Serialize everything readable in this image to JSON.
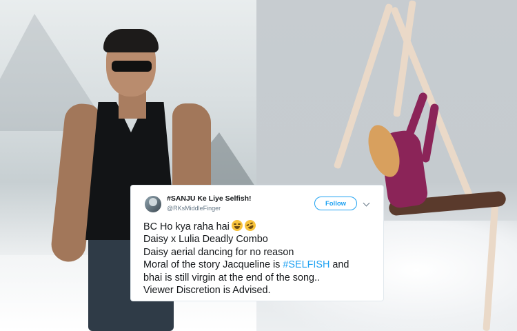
{
  "tweet": {
    "display_name": "#SANJU Ke Liye Selfish!",
    "handle": "@RKsMiddleFinger",
    "follow_label": "Follow",
    "lines": {
      "l1": "BC Ho kya raha hai",
      "l2": "Daisy x Lulia Deadly Combo",
      "l3": "Daisy aerial dancing for no reason",
      "l4_prefix": "Moral of the story Jacqueline is ",
      "l4_hashtag": "#SELFISH",
      "l4_suffix": " and",
      "l5": "bhai is still virgin at the end of the song..",
      "l6": "Viewer Discretion is Advised."
    },
    "emojis": [
      "face-with-tears-of-joy-icon",
      "rolling-on-floor-laughing-icon"
    ]
  },
  "colors": {
    "accent": "#1da1f2",
    "text": "#14171a",
    "secondary": "#657786"
  }
}
